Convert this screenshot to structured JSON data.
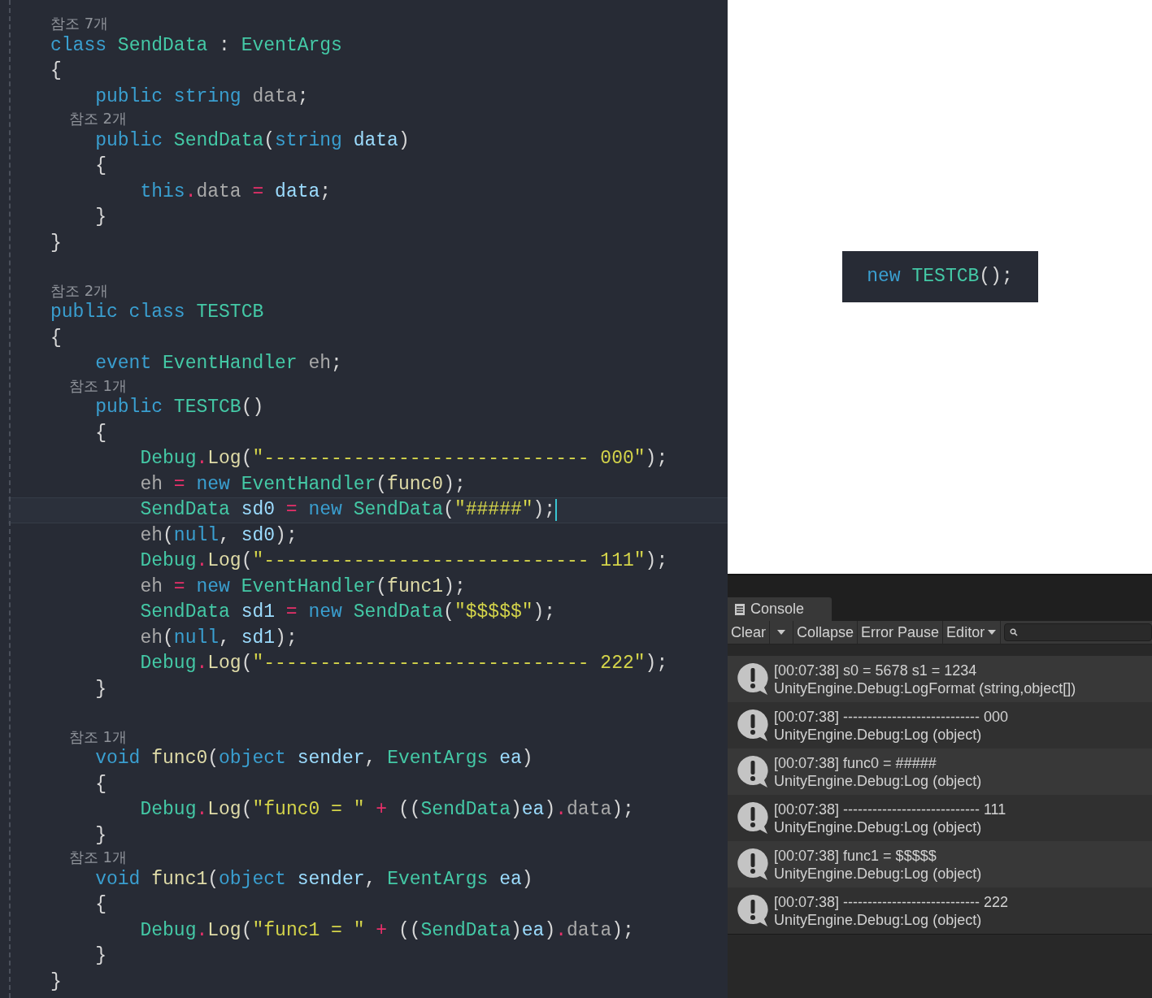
{
  "editor": {
    "lines": [
      {
        "kind": "lens",
        "text": "참조 7개"
      },
      {
        "kind": "code",
        "current": false,
        "tokens": [
          {
            "text": "class ",
            "kind": "kw"
          },
          {
            "text": "SendData",
            "kind": "type"
          },
          {
            "text": " : ",
            "kind": "punc"
          },
          {
            "text": "EventArgs",
            "kind": "type"
          }
        ]
      },
      {
        "kind": "code",
        "current": false,
        "tokens": [
          {
            "text": "{",
            "kind": "punc"
          }
        ]
      },
      {
        "kind": "code",
        "current": false,
        "tokens": [
          {
            "text": "    public string ",
            "kind": "kw"
          },
          {
            "text": "data",
            "kind": "field"
          },
          {
            "text": ";",
            "kind": "punc"
          }
        ]
      },
      {
        "kind": "lens",
        "text": "    참조 2개"
      },
      {
        "kind": "code",
        "current": false,
        "tokens": [
          {
            "text": "    public ",
            "kind": "kw"
          },
          {
            "text": "SendData",
            "kind": "type"
          },
          {
            "text": "(",
            "kind": "punc"
          },
          {
            "text": "string ",
            "kind": "kw"
          },
          {
            "text": "data",
            "kind": "var"
          },
          {
            "text": ")",
            "kind": "punc"
          }
        ]
      },
      {
        "kind": "code",
        "current": false,
        "tokens": [
          {
            "text": "    {",
            "kind": "punc"
          }
        ]
      },
      {
        "kind": "code",
        "current": false,
        "tokens": [
          {
            "text": "        this",
            "kind": "kw"
          },
          {
            "text": ".",
            "kind": "op"
          },
          {
            "text": "data ",
            "kind": "field"
          },
          {
            "text": "= ",
            "kind": "op"
          },
          {
            "text": "data",
            "kind": "var"
          },
          {
            "text": ";",
            "kind": "punc"
          }
        ]
      },
      {
        "kind": "code",
        "current": false,
        "tokens": [
          {
            "text": "    }",
            "kind": "punc"
          }
        ]
      },
      {
        "kind": "code",
        "current": false,
        "tokens": [
          {
            "text": "}",
            "kind": "punc"
          }
        ]
      },
      {
        "kind": "blank"
      },
      {
        "kind": "lens",
        "text": "참조 2개"
      },
      {
        "kind": "code",
        "current": false,
        "tokens": [
          {
            "text": "public class ",
            "kind": "kw"
          },
          {
            "text": "TESTCB",
            "kind": "type"
          }
        ]
      },
      {
        "kind": "code",
        "current": false,
        "tokens": [
          {
            "text": "{",
            "kind": "punc"
          }
        ]
      },
      {
        "kind": "code",
        "current": false,
        "tokens": [
          {
            "text": "    event ",
            "kind": "kw"
          },
          {
            "text": "EventHandler ",
            "kind": "type"
          },
          {
            "text": "eh",
            "kind": "field"
          },
          {
            "text": ";",
            "kind": "punc"
          }
        ]
      },
      {
        "kind": "lens",
        "text": "    참조 1개"
      },
      {
        "kind": "code",
        "current": false,
        "tokens": [
          {
            "text": "    public ",
            "kind": "kw"
          },
          {
            "text": "TESTCB",
            "kind": "type"
          },
          {
            "text": "()",
            "kind": "punc"
          }
        ]
      },
      {
        "kind": "code",
        "current": false,
        "tokens": [
          {
            "text": "    {",
            "kind": "punc"
          }
        ]
      },
      {
        "kind": "code",
        "current": false,
        "tokens": [
          {
            "text": "        Debug",
            "kind": "type"
          },
          {
            "text": ".",
            "kind": "op"
          },
          {
            "text": "Log",
            "kind": "fn"
          },
          {
            "text": "(",
            "kind": "punc"
          },
          {
            "text": "\"----------------------------- 000\"",
            "kind": "str"
          },
          {
            "text": ");",
            "kind": "punc"
          }
        ]
      },
      {
        "kind": "code",
        "current": false,
        "tokens": [
          {
            "text": "        eh ",
            "kind": "field"
          },
          {
            "text": "= ",
            "kind": "op"
          },
          {
            "text": "new ",
            "kind": "kw"
          },
          {
            "text": "EventHandler",
            "kind": "type"
          },
          {
            "text": "(",
            "kind": "punc"
          },
          {
            "text": "func0",
            "kind": "fn"
          },
          {
            "text": ");",
            "kind": "punc"
          }
        ]
      },
      {
        "kind": "code",
        "current": true,
        "tokens": [
          {
            "text": "        SendData ",
            "kind": "type"
          },
          {
            "text": "sd0 ",
            "kind": "var"
          },
          {
            "text": "= ",
            "kind": "op"
          },
          {
            "text": "new ",
            "kind": "kw"
          },
          {
            "text": "SendData",
            "kind": "type"
          },
          {
            "text": "(",
            "kind": "punc"
          },
          {
            "text": "\"#####\"",
            "kind": "str"
          },
          {
            "text": ");",
            "kind": "punc"
          }
        ]
      },
      {
        "kind": "code",
        "current": false,
        "tokens": [
          {
            "text": "        eh",
            "kind": "field"
          },
          {
            "text": "(",
            "kind": "punc"
          },
          {
            "text": "null",
            "kind": "kw"
          },
          {
            "text": ", ",
            "kind": "punc"
          },
          {
            "text": "sd0",
            "kind": "var"
          },
          {
            "text": ");",
            "kind": "punc"
          }
        ]
      },
      {
        "kind": "code",
        "current": false,
        "tokens": [
          {
            "text": "        Debug",
            "kind": "type"
          },
          {
            "text": ".",
            "kind": "op"
          },
          {
            "text": "Log",
            "kind": "fn"
          },
          {
            "text": "(",
            "kind": "punc"
          },
          {
            "text": "\"----------------------------- 111\"",
            "kind": "str"
          },
          {
            "text": ");",
            "kind": "punc"
          }
        ]
      },
      {
        "kind": "code",
        "current": false,
        "tokens": [
          {
            "text": "        eh ",
            "kind": "field"
          },
          {
            "text": "= ",
            "kind": "op"
          },
          {
            "text": "new ",
            "kind": "kw"
          },
          {
            "text": "EventHandler",
            "kind": "type"
          },
          {
            "text": "(",
            "kind": "punc"
          },
          {
            "text": "func1",
            "kind": "fn"
          },
          {
            "text": ");",
            "kind": "punc"
          }
        ]
      },
      {
        "kind": "code",
        "current": false,
        "tokens": [
          {
            "text": "        SendData ",
            "kind": "type"
          },
          {
            "text": "sd1 ",
            "kind": "var"
          },
          {
            "text": "= ",
            "kind": "op"
          },
          {
            "text": "new ",
            "kind": "kw"
          },
          {
            "text": "SendData",
            "kind": "type"
          },
          {
            "text": "(",
            "kind": "punc"
          },
          {
            "text": "\"$$$$$\"",
            "kind": "str"
          },
          {
            "text": ");",
            "kind": "punc"
          }
        ]
      },
      {
        "kind": "code",
        "current": false,
        "tokens": [
          {
            "text": "        eh",
            "kind": "field"
          },
          {
            "text": "(",
            "kind": "punc"
          },
          {
            "text": "null",
            "kind": "kw"
          },
          {
            "text": ", ",
            "kind": "punc"
          },
          {
            "text": "sd1",
            "kind": "var"
          },
          {
            "text": ");",
            "kind": "punc"
          }
        ]
      },
      {
        "kind": "code",
        "current": false,
        "tokens": [
          {
            "text": "        Debug",
            "kind": "type"
          },
          {
            "text": ".",
            "kind": "op"
          },
          {
            "text": "Log",
            "kind": "fn"
          },
          {
            "text": "(",
            "kind": "punc"
          },
          {
            "text": "\"----------------------------- 222\"",
            "kind": "str"
          },
          {
            "text": ");",
            "kind": "punc"
          }
        ]
      },
      {
        "kind": "code",
        "current": false,
        "tokens": [
          {
            "text": "    }",
            "kind": "punc"
          }
        ]
      },
      {
        "kind": "blank"
      },
      {
        "kind": "lens",
        "text": "    참조 1개"
      },
      {
        "kind": "code",
        "current": false,
        "tokens": [
          {
            "text": "    void ",
            "kind": "kw"
          },
          {
            "text": "func0",
            "kind": "fn"
          },
          {
            "text": "(",
            "kind": "punc"
          },
          {
            "text": "object ",
            "kind": "kw"
          },
          {
            "text": "sender",
            "kind": "var"
          },
          {
            "text": ", ",
            "kind": "punc"
          },
          {
            "text": "EventArgs ",
            "kind": "type"
          },
          {
            "text": "ea",
            "kind": "var"
          },
          {
            "text": ")",
            "kind": "punc"
          }
        ]
      },
      {
        "kind": "code",
        "current": false,
        "tokens": [
          {
            "text": "    {",
            "kind": "punc"
          }
        ]
      },
      {
        "kind": "code",
        "current": false,
        "tokens": [
          {
            "text": "        Debug",
            "kind": "type"
          },
          {
            "text": ".",
            "kind": "op"
          },
          {
            "text": "Log",
            "kind": "fn"
          },
          {
            "text": "(",
            "kind": "punc"
          },
          {
            "text": "\"func0 = \"",
            "kind": "str"
          },
          {
            "text": " + ",
            "kind": "op"
          },
          {
            "text": "((",
            "kind": "punc"
          },
          {
            "text": "SendData",
            "kind": "type"
          },
          {
            "text": ")",
            "kind": "punc"
          },
          {
            "text": "ea",
            "kind": "var"
          },
          {
            "text": ")",
            "kind": "punc"
          },
          {
            "text": ".",
            "kind": "op"
          },
          {
            "text": "data",
            "kind": "field"
          },
          {
            "text": ");",
            "kind": "punc"
          }
        ]
      },
      {
        "kind": "code",
        "current": false,
        "tokens": [
          {
            "text": "    }",
            "kind": "punc"
          }
        ]
      },
      {
        "kind": "lens",
        "text": "    참조 1개"
      },
      {
        "kind": "code",
        "current": false,
        "tokens": [
          {
            "text": "    void ",
            "kind": "kw"
          },
          {
            "text": "func1",
            "kind": "fn"
          },
          {
            "text": "(",
            "kind": "punc"
          },
          {
            "text": "object ",
            "kind": "kw"
          },
          {
            "text": "sender",
            "kind": "var"
          },
          {
            "text": ", ",
            "kind": "punc"
          },
          {
            "text": "EventArgs ",
            "kind": "type"
          },
          {
            "text": "ea",
            "kind": "var"
          },
          {
            "text": ")",
            "kind": "punc"
          }
        ]
      },
      {
        "kind": "code",
        "current": false,
        "tokens": [
          {
            "text": "    {",
            "kind": "punc"
          }
        ]
      },
      {
        "kind": "code",
        "current": false,
        "tokens": [
          {
            "text": "        Debug",
            "kind": "type"
          },
          {
            "text": ".",
            "kind": "op"
          },
          {
            "text": "Log",
            "kind": "fn"
          },
          {
            "text": "(",
            "kind": "punc"
          },
          {
            "text": "\"func1 = \"",
            "kind": "str"
          },
          {
            "text": " + ",
            "kind": "op"
          },
          {
            "text": "((",
            "kind": "punc"
          },
          {
            "text": "SendData",
            "kind": "type"
          },
          {
            "text": ")",
            "kind": "punc"
          },
          {
            "text": "ea",
            "kind": "var"
          },
          {
            "text": ")",
            "kind": "punc"
          },
          {
            "text": ".",
            "kind": "op"
          },
          {
            "text": "data",
            "kind": "field"
          },
          {
            "text": ");",
            "kind": "punc"
          }
        ]
      },
      {
        "kind": "code",
        "current": false,
        "tokens": [
          {
            "text": "    }",
            "kind": "punc"
          }
        ]
      },
      {
        "kind": "code",
        "current": false,
        "tokens": [
          {
            "text": "}",
            "kind": "punc"
          }
        ]
      }
    ]
  },
  "snippet": {
    "tokens": [
      {
        "text": "new ",
        "kind": "kw"
      },
      {
        "text": "TESTCB",
        "kind": "type"
      },
      {
        "text": "();",
        "kind": "punc"
      }
    ]
  },
  "console": {
    "tab": "Console",
    "toolbar": [
      {
        "label": "Clear",
        "kind": "button"
      },
      {
        "kind": "dropdown"
      },
      {
        "label": "Collapse",
        "kind": "button"
      },
      {
        "label": "Error Pause",
        "kind": "button"
      },
      {
        "label": "Editor",
        "kind": "menu"
      },
      {
        "kind": "search"
      }
    ],
    "entries": [
      {
        "message": "[00:07:38] s0 = 5678 s1 = 1234",
        "trace": "UnityEngine.Debug:LogFormat (string,object[])"
      },
      {
        "message": "[00:07:38] ---------------------------- 000",
        "trace": "UnityEngine.Debug:Log (object)"
      },
      {
        "message": "[00:07:38] func0 = #####",
        "trace": "UnityEngine.Debug:Log (object)"
      },
      {
        "message": "[00:07:38] ---------------------------- 111",
        "trace": "UnityEngine.Debug:Log (object)"
      },
      {
        "message": "[00:07:38] func1 = $$$$$",
        "trace": "UnityEngine.Debug:Log (object)"
      },
      {
        "message": "[00:07:38] ---------------------------- 222",
        "trace": "UnityEngine.Debug:Log (object)"
      }
    ]
  }
}
